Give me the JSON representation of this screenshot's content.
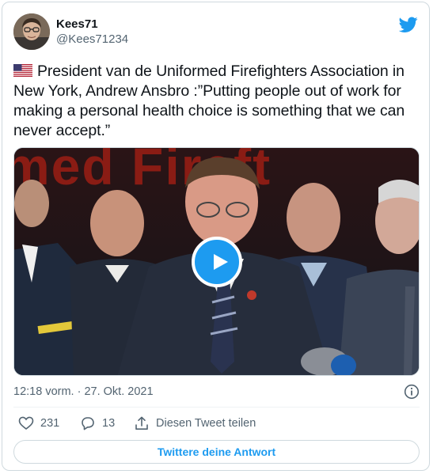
{
  "tweet": {
    "author": {
      "display_name": "Kees71",
      "handle": "@Kees71234"
    },
    "flag_icon": "us-flag-icon",
    "text": "President van de Uniformed Firefighters Association in New York, Andrew Ansbro :”Putting people out of work for making a personal health choice is something that we can never accept.”",
    "media": {
      "type": "video",
      "background_text": "med Fireft"
    },
    "timestamp": "12:18 vorm. · 27. Okt. 2021",
    "actions": {
      "like_count": "231",
      "reply_count": "13",
      "share_label": "Diesen Tweet teilen"
    },
    "reply_button_label": "Twittere deine Antwort"
  },
  "colors": {
    "accent": "#1d9bf0",
    "text_primary": "#0f1419",
    "text_secondary": "#536471",
    "border": "#cfd9de"
  },
  "icons": [
    "twitter-bird-icon",
    "play-icon",
    "info-icon",
    "heart-icon",
    "reply-icon",
    "share-icon"
  ]
}
